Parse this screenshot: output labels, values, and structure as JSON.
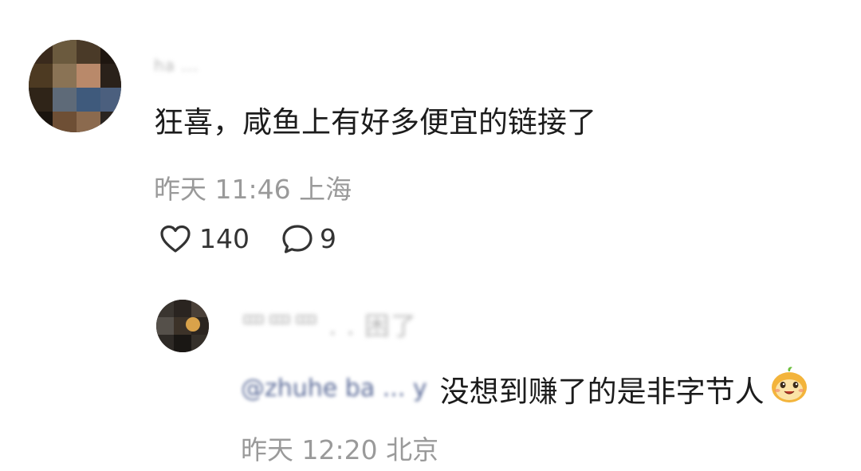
{
  "comment": {
    "username": "ha ...",
    "content": "狂喜，咸鱼上有好多便宜的链接了",
    "meta": "昨天 11:46 上海",
    "likes": "140",
    "replies": "9",
    "avatar_icon": "pixelated-user-avatar",
    "like_icon": "heart-outline-icon",
    "reply_icon": "speech-bubble-outline-icon"
  },
  "reply": {
    "username": "罒罒罒 . . 困了",
    "mention": "@zhuhe ba ... y",
    "content": "没想到赚了的是非字节人",
    "meta": "昨天 12:20 北京",
    "avatar_icon": "pixelated-user-avatar",
    "emoji_icon": "orange-face-emoji"
  },
  "colors": {
    "text": "#1c1c1c",
    "meta": "#9a9a9a",
    "mention": "#5b6b98"
  }
}
